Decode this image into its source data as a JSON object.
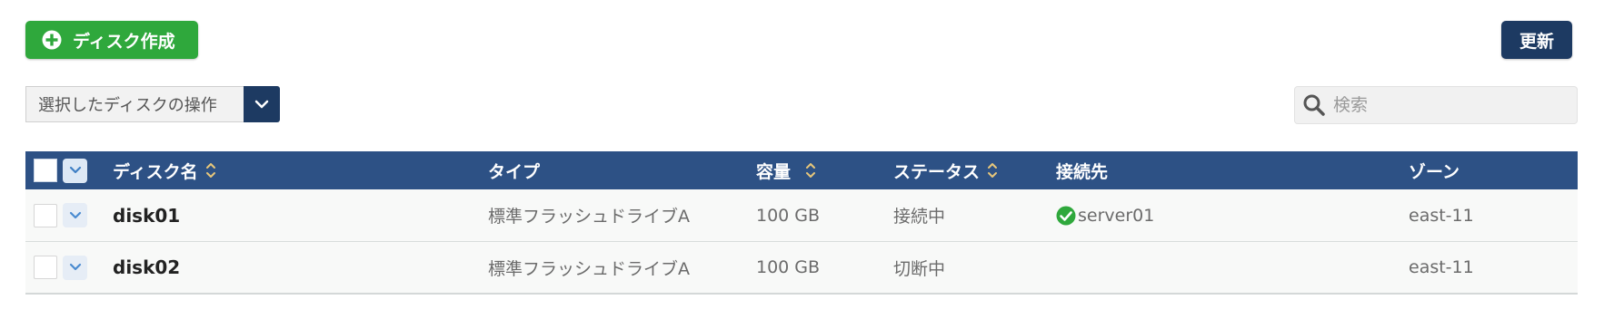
{
  "toolbar": {
    "create_label": "ディスク作成",
    "refresh_label": "更新",
    "bulk_action_label": "選択したディスクの操作",
    "search_placeholder": "検索"
  },
  "table": {
    "columns": [
      "ディスク名",
      "タイプ",
      "容量",
      "ステータス",
      "接続先",
      "ゾーン"
    ],
    "rows": [
      {
        "name": "disk01",
        "type": "標準フラッシュドライブA",
        "capacity": "100 GB",
        "status": "接続中",
        "connected_to": "server01",
        "zone": "east-11"
      },
      {
        "name": "disk02",
        "type": "標準フラッシュドライブA",
        "capacity": "100 GB",
        "status": "切断中",
        "connected_to": "",
        "zone": "east-11"
      }
    ]
  },
  "colors": {
    "create_button": "#2fa83c",
    "refresh_button": "#1d3a62",
    "table_header": "#2d5185",
    "status_ok": "#2fa83c",
    "sort_icon": "#e8c77a"
  },
  "icons": {
    "create": "plus-circle-icon",
    "dropdown": "chevron-down-icon",
    "search": "search-icon",
    "sort": "sort-icon",
    "connected": "check-circle-icon"
  }
}
